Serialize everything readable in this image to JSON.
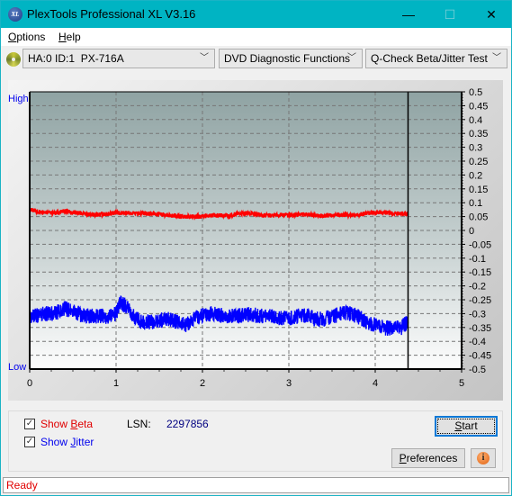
{
  "window": {
    "title": "PlexTools Professional XL V3.16",
    "app_icon": "xl-logo-icon",
    "controls": {
      "minimize": "—",
      "maximize": "☐",
      "close": "✕"
    }
  },
  "menu": {
    "items": [
      {
        "label": "Options",
        "accel": "O",
        "rest": "ptions"
      },
      {
        "label": "Help",
        "accel": "H",
        "rest": "elp"
      }
    ]
  },
  "toolbar": {
    "drive_icon": "disc-icon",
    "drive_select": "HA:0 ID:1  PX-716A",
    "function_select": "DVD Diagnostic Functions",
    "test_select": "Q-Check Beta/Jitter Test"
  },
  "chart_data": {
    "type": "line",
    "title": "",
    "xlabel": "",
    "ylabel": "",
    "y_top_label": "High",
    "y_bottom_label": "Low",
    "xlim": [
      0,
      5
    ],
    "ylim": [
      -0.5,
      0.5
    ],
    "x_ticks": [
      "0",
      "1",
      "2",
      "3",
      "4",
      "5"
    ],
    "y_ticks": [
      "0.5",
      "0.45",
      "0.4",
      "0.35",
      "0.3",
      "0.25",
      "0.2",
      "0.15",
      "0.1",
      "0.05",
      "0",
      "-0.05",
      "-0.1",
      "-0.15",
      "-0.2",
      "-0.25",
      "-0.3",
      "-0.35",
      "-0.4",
      "-0.45",
      "-0.5"
    ],
    "grid": true,
    "end_marker_x": 4.38,
    "series": [
      {
        "name": "Beta",
        "color": "#ff0000",
        "x": [
          0,
          0.1,
          0.2,
          0.3,
          0.4,
          0.5,
          0.6,
          0.7,
          0.8,
          0.9,
          1.0,
          1.1,
          1.2,
          1.3,
          1.4,
          1.5,
          1.6,
          1.7,
          1.8,
          1.9,
          2.0,
          2.1,
          2.2,
          2.3,
          2.4,
          2.5,
          2.6,
          2.7,
          2.8,
          2.9,
          3.0,
          3.1,
          3.2,
          3.3,
          3.4,
          3.5,
          3.6,
          3.7,
          3.8,
          3.9,
          4.0,
          4.1,
          4.2,
          4.3,
          4.38
        ],
        "values": [
          0.075,
          0.068,
          0.064,
          0.063,
          0.07,
          0.066,
          0.062,
          0.057,
          0.057,
          0.058,
          0.065,
          0.064,
          0.062,
          0.061,
          0.06,
          0.058,
          0.056,
          0.052,
          0.05,
          0.05,
          0.05,
          0.055,
          0.054,
          0.052,
          0.06,
          0.062,
          0.06,
          0.055,
          0.054,
          0.056,
          0.055,
          0.057,
          0.058,
          0.055,
          0.052,
          0.055,
          0.056,
          0.055,
          0.055,
          0.063,
          0.064,
          0.066,
          0.062,
          0.06,
          0.058
        ]
      },
      {
        "name": "Jitter",
        "color": "#0000ff",
        "x": [
          0,
          0.1,
          0.2,
          0.3,
          0.4,
          0.5,
          0.6,
          0.7,
          0.8,
          0.9,
          1.0,
          1.05,
          1.1,
          1.2,
          1.3,
          1.4,
          1.5,
          1.6,
          1.7,
          1.8,
          1.9,
          2.0,
          2.1,
          2.2,
          2.3,
          2.4,
          2.5,
          2.6,
          2.7,
          2.8,
          2.9,
          3.0,
          3.1,
          3.2,
          3.3,
          3.4,
          3.5,
          3.6,
          3.7,
          3.8,
          3.9,
          4.0,
          4.1,
          4.2,
          4.3,
          4.38
        ],
        "values": [
          -0.31,
          -0.305,
          -0.3,
          -0.3,
          -0.28,
          -0.29,
          -0.305,
          -0.31,
          -0.31,
          -0.31,
          -0.3,
          -0.26,
          -0.27,
          -0.31,
          -0.33,
          -0.33,
          -0.325,
          -0.32,
          -0.33,
          -0.34,
          -0.32,
          -0.305,
          -0.3,
          -0.305,
          -0.31,
          -0.31,
          -0.305,
          -0.305,
          -0.31,
          -0.31,
          -0.315,
          -0.32,
          -0.31,
          -0.305,
          -0.32,
          -0.32,
          -0.31,
          -0.3,
          -0.3,
          -0.31,
          -0.33,
          -0.34,
          -0.35,
          -0.355,
          -0.35,
          -0.33
        ]
      }
    ]
  },
  "controls": {
    "show_beta": {
      "label_pre": "Show ",
      "accel": "B",
      "label_post": "eta",
      "checked": true,
      "check": "✓"
    },
    "show_jitter": {
      "label_pre": "Show ",
      "accel": "J",
      "label_post": "itter",
      "checked": true,
      "check": "✓"
    },
    "lsn_label": "LSN:",
    "lsn_value": "2297856",
    "start": {
      "accel": "S",
      "rest": "tart"
    },
    "preferences": {
      "accel": "P",
      "rest": "references"
    },
    "info_icon": "i"
  },
  "status": {
    "text": "Ready"
  }
}
